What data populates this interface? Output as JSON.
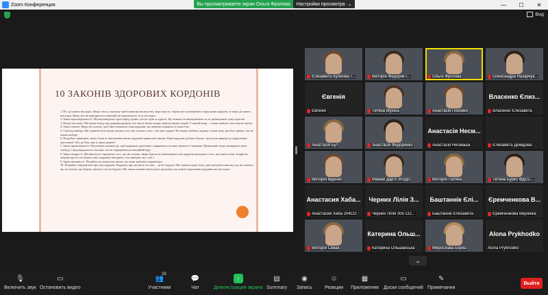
{
  "window": {
    "title": "Zoom Конференция",
    "minimize": "—",
    "maximize": "☐",
    "close": "✕"
  },
  "banner": {
    "viewing": "Вы просматриваете экран Ольга Фролова",
    "settings": "Настройки просмотра",
    "caret": "⌄"
  },
  "view": {
    "label": "Вид"
  },
  "slide": {
    "title": "10 ЗАКОНІВ ЗДОРОВИХ КОРДОНІВ",
    "body": "1. Всі дії мають наслідки. Якщо хтось у вашому житті виявляв насильство, жорстокість, образи чи систематично порушував кордони, то ваші дії мають наслідки. Якщо все не відбувається зазвичай, ви відповідаєте за ці наслідки.\n2. Закон відповідальності. Ми відповідаємо один перед одним, але не один за одного. Це означає не маніпулювати та не провокувати чужу агресію.\n3. Влада має межі. Ми маємо владу над деякими речами, але ми не маємо влади змінити інших людей. У нашій владі – тільки змінити своє власне життя.\n4. Закон поваги. Якщо ми хочемо, щоб інші поважали наші кордони, ми повинні поважати їх межі теж.\n5. Свобода вибору. Ми повинні бути вільні сказати «ні» або сказати «так» з чистим серцем. Не можна любити людину тільки тому, що його цінять і ми не маємо вибору.\n6. Потрібно оцінювати, якого болю встановлення наших кордонів приносить іншим. Наші кордони роблять більше, що потім приведе до відділення і зростання? Або де біль, яка їх лише ранить?\n7. Закон проактивності. Ми робимо активні дії, щоб вирішити проблеми, спираючись на наші цінності і бажання. Проактивні люди захищають свою свободу і відповідальність назовні, але не підкорюються емоційній бурі.\n8. Закон заздрості. Ми ніколи не отримаємо того, що ми хочемо, якщо будемо встановлювати свої кордони виходячи з того, що мають інші. Заздрісна людина просто не бачить своїх кордонів виходячи з тих виборів, які у неї є.\n9. Закон активності. Потрібно не чекати від інших, що вони зроблять перший рух.\n10. Потрібно повідомляти про свої кордони. Кордони, про які ніхто не знає, – це не кордон. Ми повинні дуже чітко дати зрозуміти іншому, що ми хочемо і що не хочемо, що будемо терпіти і що не будемо. Ми також повинні вміти дати зрозуміти, що кожне порушення кордонів має наслідки."
  },
  "participants": [
    {
      "big": "",
      "label": "Єлизавета Кулікова Г...",
      "photo": true,
      "muted": true
    },
    {
      "big": "",
      "label": "Вікторія Федорик I...",
      "photo": true,
      "muted": true
    },
    {
      "big": "",
      "label": "Ольга Фролова",
      "photo": true,
      "muted": true,
      "active": true
    },
    {
      "big": "",
      "label": "Олександра Назарчук...",
      "photo": true,
      "muted": true
    },
    {
      "big": "Євгенія",
      "label": "Євгенія",
      "photo": false,
      "muted": true
    },
    {
      "big": "",
      "label": "Тетяна Мухіна",
      "photo": true,
      "muted": true
    },
    {
      "big": "",
      "label": "Анастасія Поховко",
      "photo": true,
      "muted": true
    },
    {
      "big": "Власенко Єлиз...",
      "label": "Власенко Єлизавета",
      "photo": false,
      "muted": true
    },
    {
      "big": "",
      "label": "Анастасія Бут",
      "photo": true,
      "muted": true
    },
    {
      "big": "",
      "label": "Анастасія Федоренко",
      "photo": true,
      "muted": true
    },
    {
      "big": "Анастасія Несм...",
      "label": "Анастасія Несмаша",
      "photo": false,
      "muted": true
    },
    {
      "big": "",
      "label": "Єлизавета Демідова",
      "photo": false,
      "muted": true
    },
    {
      "big": "",
      "label": "Вікторія Івденко",
      "photo": true,
      "muted": true
    },
    {
      "big": "",
      "label": "Мамай Дар'я 303ДО",
      "photo": true,
      "muted": true
    },
    {
      "big": "",
      "label": "Вікторія Патика",
      "photo": true,
      "muted": true
    },
    {
      "big": "",
      "label": "Тетяна Бурко ФДСС...",
      "photo": true,
      "muted": true
    },
    {
      "big": "Анастасия Хаба...",
      "label": "Анастасия Хаба 204СО",
      "photo": false,
      "muted": true
    },
    {
      "big": "Черних Лілія З...",
      "label": "Черних Лілія 305 СО...",
      "photo": false,
      "muted": true
    },
    {
      "big": "Баштаннік Єлі...",
      "label": "Баштаннік Єлизавета",
      "photo": false,
      "muted": true
    },
    {
      "big": "Єремченкова В...",
      "label": "Єремченкова Вероніка",
      "photo": false,
      "muted": true
    },
    {
      "big": "",
      "label": "Вікторія Сивак",
      "photo": true,
      "muted": true
    },
    {
      "big": "Катерина Ольш...",
      "label": "Катерина Ольшанська",
      "photo": false,
      "muted": true
    },
    {
      "big": "",
      "label": "Мирослава Борка",
      "photo": true,
      "muted": true
    },
    {
      "big": "Alona Prykhodko",
      "label": "Alona Prykhodko",
      "photo": false,
      "muted": false
    }
  ],
  "toolbar": {
    "mic": "Включить звук",
    "video": "Остановить видео",
    "participants": "Участники",
    "participants_count": "29",
    "chat": "Чат",
    "share": "Демонстрация экрана",
    "summary": "Summary",
    "record": "Запись",
    "reactions": "Реакции",
    "apps": "Приложения",
    "whiteboard": "Доски сообщений",
    "notes": "Примечания",
    "leave": "Выйти"
  },
  "colors": {
    "share_accent": "#23c15a",
    "leave": "#e02020",
    "active_speaker": "#f0e000"
  }
}
